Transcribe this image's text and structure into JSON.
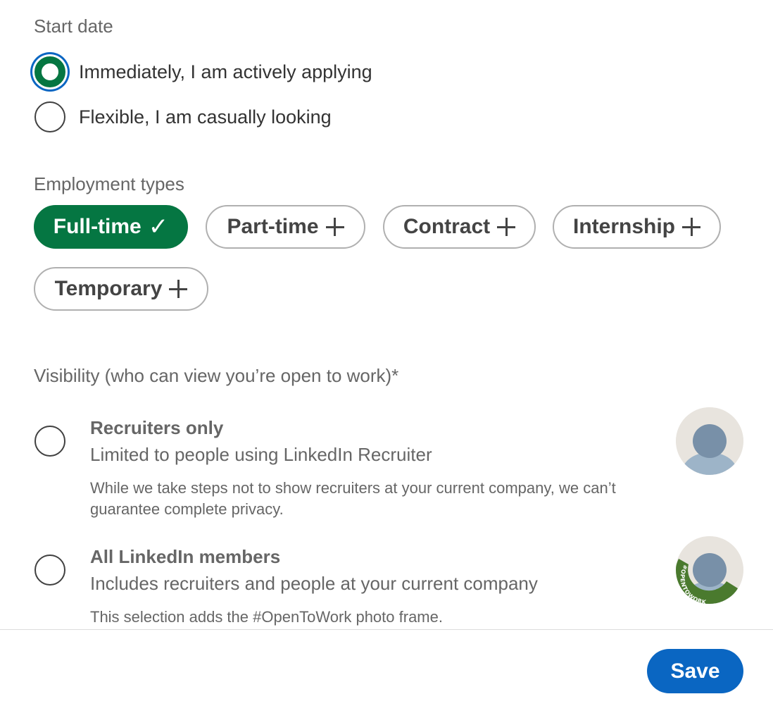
{
  "start_date": {
    "label": "Start date",
    "options": [
      {
        "label": "Immediately, I am actively applying",
        "selected": true
      },
      {
        "label": "Flexible, I am casually looking",
        "selected": false
      }
    ]
  },
  "employment_types": {
    "label": "Employment types",
    "pills": [
      {
        "label": "Full-time",
        "selected": true,
        "icon": "check-icon"
      },
      {
        "label": "Part-time",
        "selected": false,
        "icon": "plus-icon"
      },
      {
        "label": "Contract",
        "selected": false,
        "icon": "plus-icon"
      },
      {
        "label": "Internship",
        "selected": false,
        "icon": "plus-icon"
      },
      {
        "label": "Temporary",
        "selected": false,
        "icon": "plus-icon"
      }
    ]
  },
  "visibility": {
    "label": "Visibility (who can view you’re open to work)*",
    "options": [
      {
        "title": "Recruiters only",
        "subtitle": "Limited to people using LinkedIn Recruiter",
        "note": "While we take steps not to show recruiters at your current company, we can’t guarantee complete privacy.",
        "selected": false,
        "avatar": "avatar-placeholder"
      },
      {
        "title": "All LinkedIn members",
        "subtitle": "Includes recruiters and people at your current company",
        "note": "This selection adds the #OpenToWork photo frame.",
        "selected": false,
        "avatar": "avatar-opentowork-frame",
        "frame_text": "#OPENTOWORK"
      }
    ]
  },
  "footer": {
    "save_label": "Save"
  },
  "colors": {
    "accent_green": "#057642",
    "primary_blue": "#0a66c2",
    "text_muted": "#666666"
  }
}
